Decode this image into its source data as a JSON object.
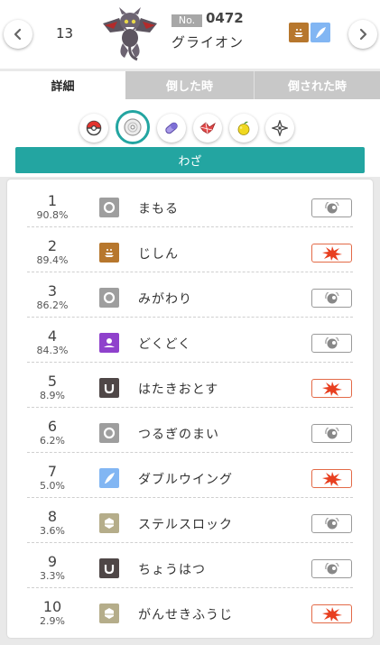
{
  "header": {
    "rank": "13",
    "no_label": "No.",
    "dex_number": "0472",
    "pokemon_name": "グライオン",
    "types": [
      {
        "name": "ground",
        "icon": "ground-type-icon",
        "color": "#b7772d"
      },
      {
        "name": "flying",
        "icon": "flying-type-icon",
        "color": "#82b6f3"
      }
    ]
  },
  "tabs": [
    {
      "label": "詳細",
      "active": true
    },
    {
      "label": "倒した時",
      "active": false
    },
    {
      "label": "倒された時",
      "active": false
    }
  ],
  "categories": [
    {
      "icon": "pokeball-icon",
      "active": false
    },
    {
      "icon": "disc-icon",
      "active": true
    },
    {
      "icon": "capsule-icon",
      "active": false
    },
    {
      "icon": "tera-crystal-icon",
      "active": false
    },
    {
      "icon": "berry-icon",
      "active": false
    },
    {
      "icon": "nature-star-icon",
      "active": false
    }
  ],
  "section_title": "わざ",
  "colors": {
    "accent": "#23a5a1",
    "status_border": "#9a9a9a",
    "physical_border": "#e36a47",
    "physical_fill": "#e83f1f"
  },
  "moves": [
    {
      "rank": "1",
      "percent": "90.8%",
      "name": "まもる",
      "type": "normal",
      "type_color": "#9e9e9e",
      "type_icon": "normal-type-icon",
      "category": "status"
    },
    {
      "rank": "2",
      "percent": "89.4%",
      "name": "じしん",
      "type": "ground",
      "type_color": "#b7772d",
      "type_icon": "ground-type-icon",
      "category": "physical"
    },
    {
      "rank": "3",
      "percent": "86.2%",
      "name": "みがわり",
      "type": "normal",
      "type_color": "#9e9e9e",
      "type_icon": "normal-type-icon",
      "category": "status"
    },
    {
      "rank": "4",
      "percent": "84.3%",
      "name": "どくどく",
      "type": "poison",
      "type_color": "#8f41cc",
      "type_icon": "poison-type-icon",
      "category": "status"
    },
    {
      "rank": "5",
      "percent": "8.9%",
      "name": "はたきおとす",
      "type": "dark",
      "type_color": "#4f4747",
      "type_icon": "dark-type-icon",
      "category": "physical"
    },
    {
      "rank": "6",
      "percent": "6.2%",
      "name": "つるぎのまい",
      "type": "normal",
      "type_color": "#9e9e9e",
      "type_icon": "normal-type-icon",
      "category": "status"
    },
    {
      "rank": "7",
      "percent": "5.0%",
      "name": "ダブルウイング",
      "type": "flying",
      "type_color": "#82b6f3",
      "type_icon": "flying-type-icon",
      "category": "physical"
    },
    {
      "rank": "8",
      "percent": "3.6%",
      "name": "ステルスロック",
      "type": "rock",
      "type_color": "#b5ad8a",
      "type_icon": "rock-type-icon",
      "category": "status"
    },
    {
      "rank": "9",
      "percent": "3.3%",
      "name": "ちょうはつ",
      "type": "dark",
      "type_color": "#4f4747",
      "type_icon": "dark-type-icon",
      "category": "status"
    },
    {
      "rank": "10",
      "percent": "2.9%",
      "name": "がんせきふうじ",
      "type": "rock",
      "type_color": "#b5ad8a",
      "type_icon": "rock-type-icon",
      "category": "physical"
    }
  ]
}
